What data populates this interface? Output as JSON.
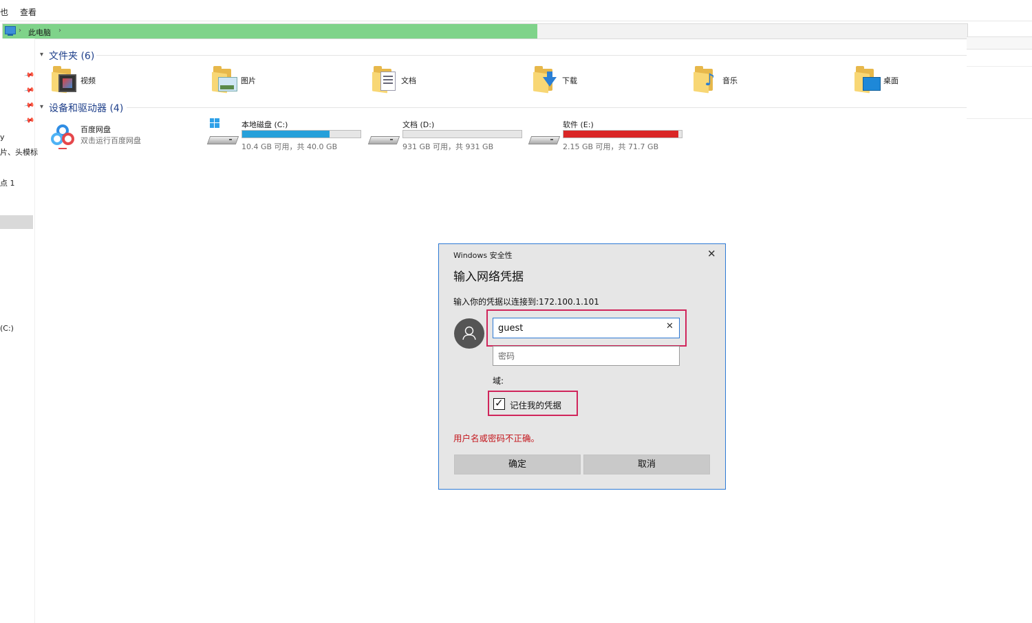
{
  "ribbon": {
    "tab_partial": "也",
    "tab_view": "查看"
  },
  "address": {
    "location": "此电脑",
    "progress_fraction": 0.555
  },
  "nav": {
    "frag_1": "y",
    "frag_2": "片、头模标",
    "frag_3": "点 1",
    "frag_4": "(C:)"
  },
  "folders_section": {
    "title": "文件夹 (6)"
  },
  "folders": [
    {
      "label": "视频",
      "icon": "video-folder-icon"
    },
    {
      "label": "图片",
      "icon": "pictures-folder-icon"
    },
    {
      "label": "文档",
      "icon": "documents-folder-icon"
    },
    {
      "label": "下载",
      "icon": "downloads-folder-icon"
    },
    {
      "label": "音乐",
      "icon": "music-folder-icon"
    },
    {
      "label": "桌面",
      "icon": "desktop-folder-icon"
    }
  ],
  "devices_section": {
    "title": "设备和驱动器 (4)"
  },
  "baidu": {
    "name": "百度网盘",
    "subtitle": "双击运行百度网盘"
  },
  "drives": [
    {
      "name": "本地磁盘 (C:)",
      "summary": "10.4 GB 可用，共 40.0 GB",
      "used_fraction": 0.74,
      "color": "#26a0da"
    },
    {
      "name": "文档 (D:)",
      "summary": "931 GB 可用，共 931 GB",
      "used_fraction": 0.0,
      "color": "#26a0da"
    },
    {
      "name": "软件 (E:)",
      "summary": "2.15 GB 可用，共 71.7 GB",
      "used_fraction": 0.97,
      "color": "#da2626"
    }
  ],
  "dialog": {
    "window_title": "Windows 安全性",
    "heading": "输入网络凭据",
    "prompt": "输入你的凭据以连接到:172.100.1.101",
    "username_value": "guest",
    "password_placeholder": "密码",
    "domain_label": "域:",
    "remember_label": "记住我的凭据",
    "remember_checked": true,
    "error": "用户名或密码不正确。",
    "ok_label": "确定",
    "cancel_label": "取消"
  },
  "colors": {
    "accent": "#2b78d4",
    "highlight": "#d0245a",
    "error": "#c4161c",
    "address_progress": "#7fd38a"
  }
}
